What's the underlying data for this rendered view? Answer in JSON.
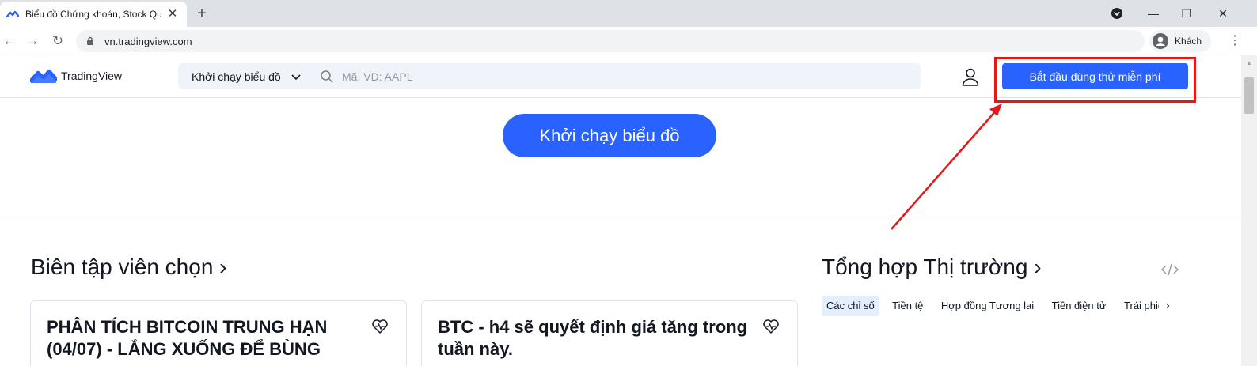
{
  "browser": {
    "tab_title": "Biểu đồ Chứng khoán, Stock Quo",
    "tab_close": "✕",
    "new_tab": "+",
    "url": "vn.tradingview.com",
    "profile_label": "Khách",
    "window_controls": {
      "minimize": "—",
      "restore": "❐",
      "close": "✕"
    },
    "nav": {
      "back": "←",
      "forward": "→",
      "reload": "↻"
    },
    "menu": "⋮"
  },
  "header": {
    "logo_text": "TradingView",
    "chart_dropdown_label": "Khởi chạy biểu đồ",
    "search_placeholder": "Mã, VD: AAPL",
    "cta_label": "Bắt đầu dùng thử miễn phí"
  },
  "hero": {
    "launch_button": "Khởi chạy biểu đồ"
  },
  "editors": {
    "title": "Biên tập viên chọn ›",
    "cards": [
      {
        "title": "PHÂN TÍCH BITCOIN TRUNG HẠN (04/07) - LẮNG XUỐNG ĐỂ BÙNG"
      },
      {
        "title": "BTC - h4 sẽ quyết định giá tăng trong tuần này."
      }
    ]
  },
  "market": {
    "title": "Tổng hợp Thị trường ›",
    "tabs": [
      "Các chỉ số",
      "Tiền tệ",
      "Hợp đồng Tương lai",
      "Tiền điện tử",
      "Trái phiếu"
    ],
    "next": "›"
  },
  "colors": {
    "brand_blue": "#2962ff",
    "annotation_red": "#e31818",
    "active_tab_bg": "#e3effd"
  }
}
